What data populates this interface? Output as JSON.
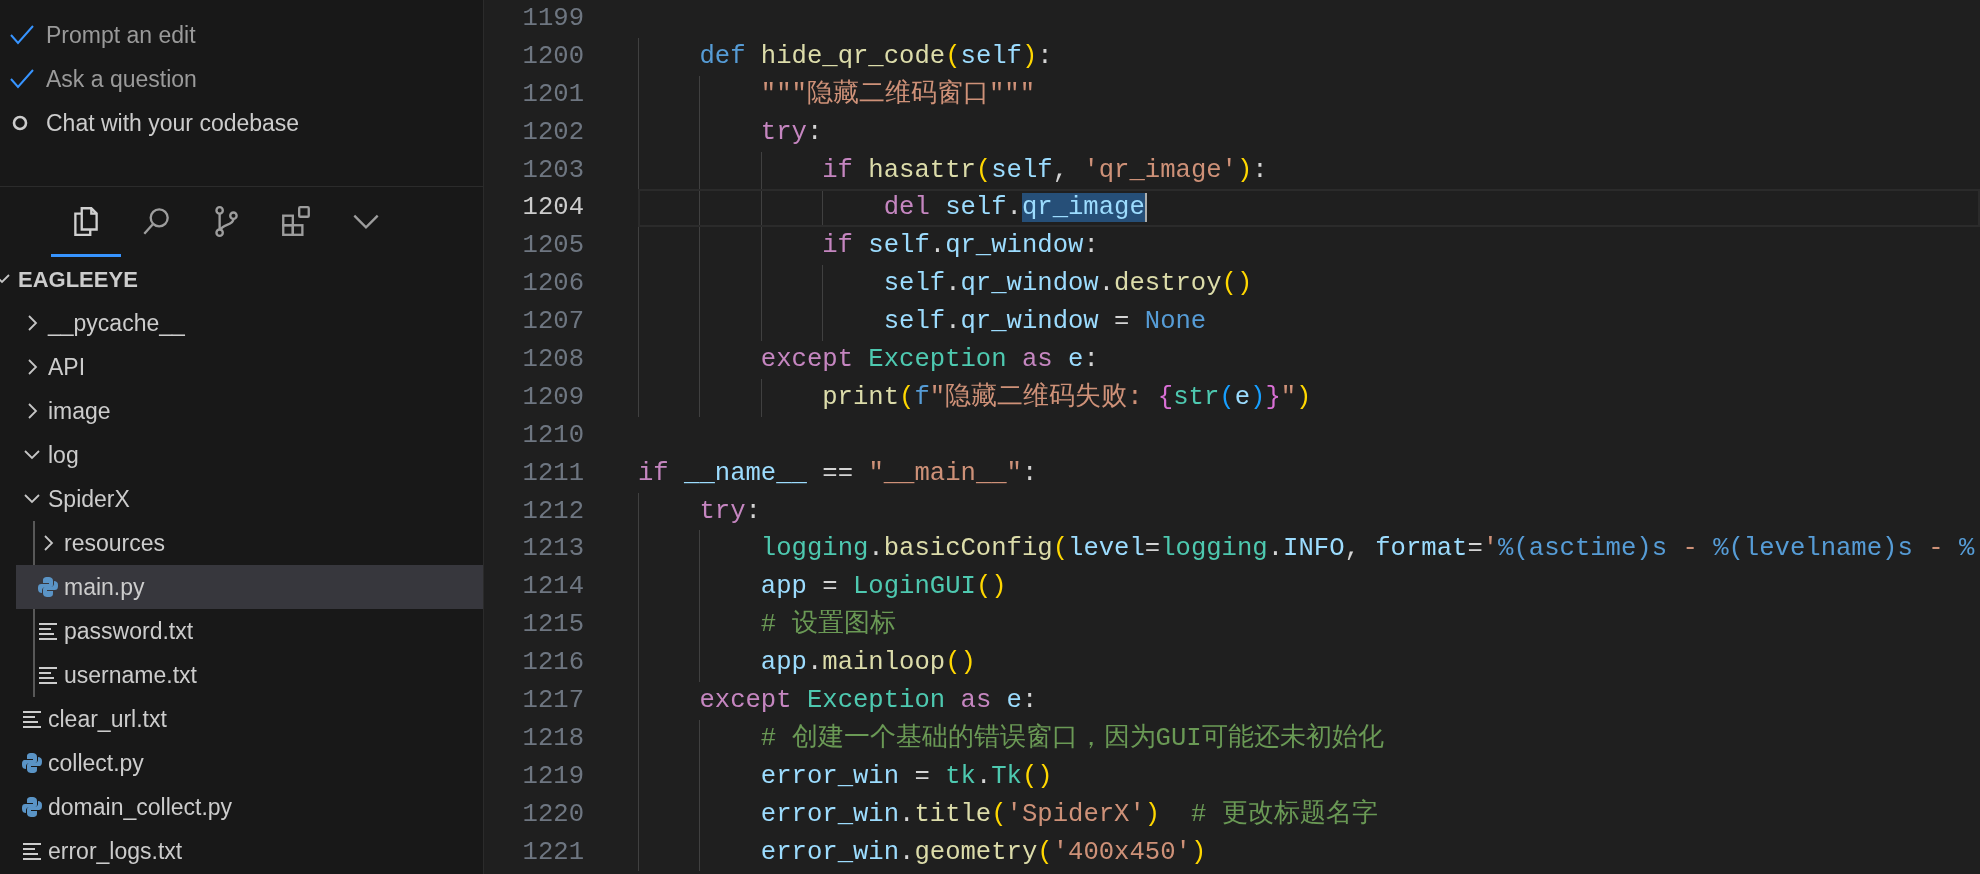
{
  "checklist": [
    {
      "label": "Prompt an edit",
      "done": true
    },
    {
      "label": "Ask a question",
      "done": true
    },
    {
      "label": "Chat with your codebase",
      "done": false
    }
  ],
  "view_tabs": [
    {
      "kind": "files",
      "selected": true
    },
    {
      "kind": "search",
      "selected": false
    },
    {
      "kind": "source-control",
      "selected": false
    },
    {
      "kind": "extensions",
      "selected": false
    },
    {
      "kind": "more",
      "selected": false
    }
  ],
  "explorer": {
    "title": "EAGLEEYE",
    "expanded": true,
    "items": [
      {
        "kind": "folder",
        "label": "__pycache__",
        "expanded": false,
        "selected": false
      },
      {
        "kind": "folder",
        "label": "API",
        "expanded": false,
        "selected": false
      },
      {
        "kind": "folder",
        "label": "image",
        "expanded": false,
        "selected": false
      },
      {
        "kind": "folder",
        "label": "log",
        "expanded": true,
        "selected": false
      },
      {
        "kind": "folder",
        "label": "SpiderX",
        "expanded": true,
        "selected": false,
        "children": [
          {
            "kind": "folder",
            "label": "resources",
            "expanded": false,
            "selected": false
          },
          {
            "kind": "python",
            "label": "main.py",
            "selected": true
          },
          {
            "kind": "text",
            "label": "password.txt",
            "selected": false
          },
          {
            "kind": "text",
            "label": "username.txt",
            "selected": false
          }
        ]
      },
      {
        "kind": "text",
        "label": "clear_url.txt",
        "selected": false
      },
      {
        "kind": "python",
        "label": "collect.py",
        "selected": false
      },
      {
        "kind": "python",
        "label": "domain_collect.py",
        "selected": false
      },
      {
        "kind": "text",
        "label": "error_logs.txt",
        "selected": false
      }
    ]
  },
  "editor": {
    "lines": [
      {
        "number": "1199",
        "current": false
      },
      {
        "number": "1200",
        "current": false,
        "tokens": [
          {
            "text": "    def ",
            "kind": "storage"
          },
          {
            "text": "hide_qr_code",
            "kind": "function"
          },
          {
            "text": "(",
            "kind": "bracket1"
          },
          {
            "text": "self",
            "kind": "variable"
          },
          {
            "text": ")",
            "kind": "bracket1"
          },
          {
            "text": ":",
            "kind": "plain"
          }
        ]
      },
      {
        "number": "1201",
        "current": false,
        "tokens": [
          {
            "text": "        \"\"\"隐藏二维码窗口\"\"\"",
            "kind": "string"
          }
        ]
      },
      {
        "number": "1202",
        "current": false,
        "tokens": [
          {
            "text": "        try",
            "kind": "keyword"
          },
          {
            "text": ":",
            "kind": "plain"
          }
        ]
      },
      {
        "number": "1203",
        "current": false,
        "tokens": [
          {
            "text": "            if ",
            "kind": "keyword"
          },
          {
            "text": "hasattr",
            "kind": "function"
          },
          {
            "text": "(",
            "kind": "bracket1"
          },
          {
            "text": "self",
            "kind": "variable"
          },
          {
            "text": ", ",
            "kind": "plain"
          },
          {
            "text": "'qr_image'",
            "kind": "string"
          },
          {
            "text": ")",
            "kind": "bracket1"
          },
          {
            "text": ":",
            "kind": "plain"
          }
        ]
      },
      {
        "number": "1204",
        "current": true,
        "tokens": [
          {
            "text": "                del ",
            "kind": "keyword"
          },
          {
            "text": "self",
            "kind": "variable"
          },
          {
            "text": ".",
            "kind": "plain"
          },
          {
            "text": "qr_image",
            "kind": "selection"
          }
        ]
      },
      {
        "number": "1205",
        "current": false,
        "tokens": [
          {
            "text": "            if ",
            "kind": "keyword"
          },
          {
            "text": "self",
            "kind": "variable"
          },
          {
            "text": ".",
            "kind": "plain"
          },
          {
            "text": "qr_window",
            "kind": "variable"
          },
          {
            "text": ":",
            "kind": "plain"
          }
        ]
      },
      {
        "number": "1206",
        "current": false,
        "tokens": [
          {
            "text": "                self",
            "kind": "variable"
          },
          {
            "text": ".",
            "kind": "plain"
          },
          {
            "text": "qr_window",
            "kind": "variable"
          },
          {
            "text": ".",
            "kind": "plain"
          },
          {
            "text": "destroy",
            "kind": "function"
          },
          {
            "text": "()",
            "kind": "bracket1"
          }
        ]
      },
      {
        "number": "1207",
        "current": false,
        "tokens": [
          {
            "text": "                self",
            "kind": "variable"
          },
          {
            "text": ".",
            "kind": "plain"
          },
          {
            "text": "qr_window",
            "kind": "variable"
          },
          {
            "text": " = ",
            "kind": "plain"
          },
          {
            "text": "None",
            "kind": "storage"
          }
        ]
      },
      {
        "number": "1208",
        "current": false,
        "tokens": [
          {
            "text": "        except ",
            "kind": "keyword"
          },
          {
            "text": "Exception",
            "kind": "class"
          },
          {
            "text": " as ",
            "kind": "keyword"
          },
          {
            "text": "e",
            "kind": "variable"
          },
          {
            "text": ":",
            "kind": "plain"
          }
        ]
      },
      {
        "number": "1209",
        "current": false,
        "tokens": [
          {
            "text": "            print",
            "kind": "function"
          },
          {
            "text": "(",
            "kind": "bracket1"
          },
          {
            "text": "f",
            "kind": "storage"
          },
          {
            "text": "\"隐藏二维码失败: ",
            "kind": "string"
          },
          {
            "text": "{",
            "kind": "bracket2"
          },
          {
            "text": "str",
            "kind": "class"
          },
          {
            "text": "(",
            "kind": "bracket3"
          },
          {
            "text": "e",
            "kind": "variable"
          },
          {
            "text": ")",
            "kind": "bracket3"
          },
          {
            "text": "}",
            "kind": "bracket2"
          },
          {
            "text": "\"",
            "kind": "string"
          },
          {
            "text": ")",
            "kind": "bracket1"
          }
        ]
      },
      {
        "number": "1210",
        "current": false
      },
      {
        "number": "1211",
        "current": false,
        "tokens": [
          {
            "text": "if ",
            "kind": "keyword"
          },
          {
            "text": "__name__",
            "kind": "variable"
          },
          {
            "text": " == ",
            "kind": "plain"
          },
          {
            "text": "\"__main__\"",
            "kind": "string"
          },
          {
            "text": ":",
            "kind": "plain"
          }
        ]
      },
      {
        "number": "1212",
        "current": false,
        "tokens": [
          {
            "text": "    try",
            "kind": "keyword"
          },
          {
            "text": ":",
            "kind": "plain"
          }
        ]
      },
      {
        "number": "1213",
        "current": false,
        "tokens": [
          {
            "text": "        logging",
            "kind": "class"
          },
          {
            "text": ".",
            "kind": "plain"
          },
          {
            "text": "basicConfig",
            "kind": "function"
          },
          {
            "text": "(",
            "kind": "bracket1"
          },
          {
            "text": "level",
            "kind": "variable"
          },
          {
            "text": "=",
            "kind": "plain"
          },
          {
            "text": "logging",
            "kind": "class"
          },
          {
            "text": ".",
            "kind": "plain"
          },
          {
            "text": "INFO",
            "kind": "variable"
          },
          {
            "text": ", ",
            "kind": "plain"
          },
          {
            "text": "format",
            "kind": "variable"
          },
          {
            "text": "=",
            "kind": "plain"
          },
          {
            "text": "'",
            "kind": "string"
          },
          {
            "text": "%(asctime)s",
            "kind": "storage"
          },
          {
            "text": " - ",
            "kind": "string"
          },
          {
            "text": "%(levelname)s",
            "kind": "storage"
          },
          {
            "text": " - ",
            "kind": "string"
          },
          {
            "text": "%",
            "kind": "storage"
          }
        ]
      },
      {
        "number": "1214",
        "current": false,
        "tokens": [
          {
            "text": "        app",
            "kind": "variable"
          },
          {
            "text": " = ",
            "kind": "plain"
          },
          {
            "text": "LoginGUI",
            "kind": "class"
          },
          {
            "text": "()",
            "kind": "bracket1"
          }
        ]
      },
      {
        "number": "1215",
        "current": false,
        "tokens": [
          {
            "text": "        # 设置图标",
            "kind": "comment"
          }
        ]
      },
      {
        "number": "1216",
        "current": false,
        "tokens": [
          {
            "text": "        app",
            "kind": "variable"
          },
          {
            "text": ".",
            "kind": "plain"
          },
          {
            "text": "mainloop",
            "kind": "function"
          },
          {
            "text": "()",
            "kind": "bracket1"
          }
        ]
      },
      {
        "number": "1217",
        "current": false,
        "tokens": [
          {
            "text": "    except ",
            "kind": "keyword"
          },
          {
            "text": "Exception",
            "kind": "class"
          },
          {
            "text": " as ",
            "kind": "keyword"
          },
          {
            "text": "e",
            "kind": "variable"
          },
          {
            "text": ":",
            "kind": "plain"
          }
        ]
      },
      {
        "number": "1218",
        "current": false,
        "tokens": [
          {
            "text": "        # 创建一个基础的错误窗口，因为GUI可能还未初始化",
            "kind": "comment"
          }
        ]
      },
      {
        "number": "1219",
        "current": false,
        "tokens": [
          {
            "text": "        error_win",
            "kind": "variable"
          },
          {
            "text": " = ",
            "kind": "plain"
          },
          {
            "text": "tk",
            "kind": "class"
          },
          {
            "text": ".",
            "kind": "plain"
          },
          {
            "text": "Tk",
            "kind": "class"
          },
          {
            "text": "()",
            "kind": "bracket1"
          }
        ]
      },
      {
        "number": "1220",
        "current": false,
        "tokens": [
          {
            "text": "        error_win",
            "kind": "variable"
          },
          {
            "text": ".",
            "kind": "plain"
          },
          {
            "text": "title",
            "kind": "function"
          },
          {
            "text": "(",
            "kind": "bracket1"
          },
          {
            "text": "'SpiderX'",
            "kind": "string"
          },
          {
            "text": ")",
            "kind": "bracket1"
          },
          {
            "text": "  # 更改标题名字",
            "kind": "comment"
          }
        ]
      },
      {
        "number": "1221",
        "current": false,
        "tokens": [
          {
            "text": "        error_win",
            "kind": "variable"
          },
          {
            "text": ".",
            "kind": "plain"
          },
          {
            "text": "geometry",
            "kind": "function"
          },
          {
            "text": "(",
            "kind": "bracket1"
          },
          {
            "text": "'400x450'",
            "kind": "string"
          },
          {
            "text": ")",
            "kind": "bracket1"
          }
        ]
      }
    ]
  }
}
